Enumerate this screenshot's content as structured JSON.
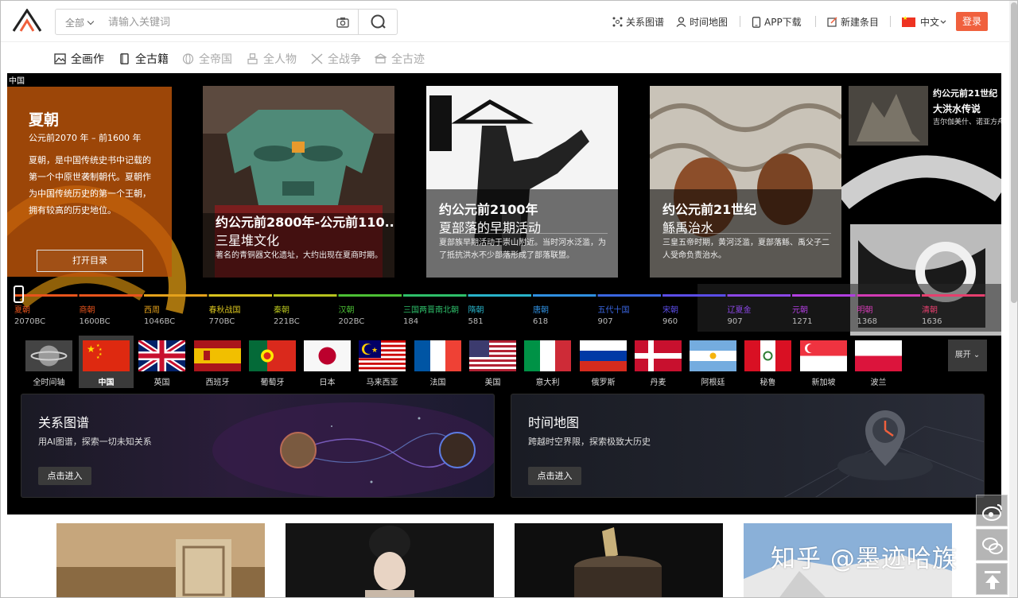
{
  "header": {
    "search_scope": "全部",
    "search_placeholder": "请输入关键词",
    "nav": [
      {
        "label": "关系图谱"
      },
      {
        "label": "时间地图"
      },
      {
        "label": "APP下载"
      },
      {
        "label": "新建条目"
      },
      {
        "label": "中文"
      }
    ],
    "login_label": "登录"
  },
  "categories": [
    {
      "label": "全画作",
      "icon": "painting-icon"
    },
    {
      "label": "全古籍",
      "icon": "book-icon"
    },
    {
      "label": "全帝国",
      "icon": "globe-icon"
    },
    {
      "label": "全人物",
      "icon": "person-icon"
    },
    {
      "label": "全战争",
      "icon": "swords-icon"
    },
    {
      "label": "全古迹",
      "icon": "monument-icon"
    }
  ],
  "hero": {
    "region_tag": "中国",
    "intro": {
      "title": "夏朝",
      "dates": "公元前2070 年 – 前1600 年",
      "text": "夏朝，是中国传统史书中记载的第一个中原世袭制朝代。夏朝作为中国传统历史的第一个王朝，拥有较高的历史地位。",
      "button": "打开目录"
    },
    "cards": [
      {
        "title": "约公元前2800年-公元前110...",
        "subtitle": "三星堆文化",
        "desc": "著名的青铜器文化遗址，大约出现在夏商时期。"
      },
      {
        "title": "约公元前2100年",
        "subtitle": "夏部落的早期活动",
        "desc": "夏部族早期活动于崇山附近。当时河水泛滥，为了抵抗洪水不少部落形成了部落联盟。"
      },
      {
        "title": "约公元前21世纪",
        "subtitle": "鲧禹治水",
        "desc": "三皇五帝时期，黄河泛滥，夏部落鲧、禹父子二人受命负责治水。"
      }
    ],
    "mini": {
      "title": "约公元前21世纪",
      "subtitle": "大洪水传说",
      "desc": "吉尔伽美什、诺亚方舟……世界各民族古传说中都…"
    },
    "timeline": [
      {
        "name": "夏朝",
        "year": "2070BC",
        "color": "#e8541c"
      },
      {
        "name": "商朝",
        "year": "1600BC",
        "color": "#e8541c"
      },
      {
        "name": "西周",
        "year": "1046BC",
        "color": "#e4a11b"
      },
      {
        "name": "春秋战国",
        "year": "770BC",
        "color": "#d8c31e"
      },
      {
        "name": "秦朝",
        "year": "221BC",
        "color": "#b6c21e"
      },
      {
        "name": "汉朝",
        "year": "202BC",
        "color": "#4cc035"
      },
      {
        "name": "三国两晋南北朝",
        "year": "184",
        "color": "#2ebf6a"
      },
      {
        "name": "隋朝",
        "year": "581",
        "color": "#28b3c9"
      },
      {
        "name": "唐朝",
        "year": "618",
        "color": "#2f8fe0"
      },
      {
        "name": "五代十国",
        "year": "907",
        "color": "#3a66e0"
      },
      {
        "name": "宋朝",
        "year": "960",
        "color": "#5b4de8"
      },
      {
        "name": "辽夏金",
        "year": "907",
        "color": "#8b47e6"
      },
      {
        "name": "元朝",
        "year": "1271",
        "color": "#b13fe0"
      },
      {
        "name": "明朝",
        "year": "1368",
        "color": "#d23bb4"
      },
      {
        "name": "清朝",
        "year": "1636",
        "color": "#e63f6e"
      }
    ],
    "flags": [
      {
        "label": "全时间轴",
        "icon": "globe-icon"
      },
      {
        "label": "中国",
        "icon": "flag-china-icon"
      },
      {
        "label": "英国",
        "icon": "flag-uk-icon"
      },
      {
        "label": "西班牙",
        "icon": "flag-spain-icon"
      },
      {
        "label": "葡萄牙",
        "icon": "flag-portugal-icon"
      },
      {
        "label": "日本",
        "icon": "flag-japan-icon"
      },
      {
        "label": "马来西亚",
        "icon": "flag-malaysia-icon"
      },
      {
        "label": "法国",
        "icon": "flag-france-icon"
      },
      {
        "label": "美国",
        "icon": "flag-usa-icon"
      },
      {
        "label": "意大利",
        "icon": "flag-italy-icon"
      },
      {
        "label": "俄罗斯",
        "icon": "flag-russia-icon"
      },
      {
        "label": "丹麦",
        "icon": "flag-denmark-icon"
      },
      {
        "label": "阿根廷",
        "icon": "flag-argentina-icon"
      },
      {
        "label": "秘鲁",
        "icon": "flag-peru-icon"
      },
      {
        "label": "新加坡",
        "icon": "flag-singapore-icon"
      },
      {
        "label": "波兰",
        "icon": "flag-poland-icon"
      }
    ],
    "expand_label": "展开"
  },
  "panels": [
    {
      "title": "关系图谱",
      "subtitle": "用AI图谱，探索一切未知关系",
      "button": "点击进入"
    },
    {
      "title": "时间地图",
      "subtitle": "跨越时空界限，探索极致大历史",
      "button": "点击进入"
    }
  ],
  "watermark": "知乎 @墨迹哈族",
  "colors": {
    "accent": "#f0603d",
    "hero_bg": "#000000",
    "intro_bg": "#be550a"
  }
}
